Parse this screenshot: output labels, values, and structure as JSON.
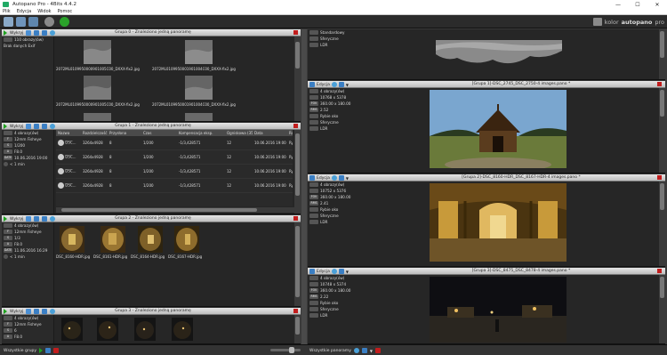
{
  "window": {
    "title": "Autopano Pro - 4Bits 4.4.2",
    "minimize": "—",
    "maximize": "☐",
    "close": "✕"
  },
  "menu": [
    "Plik",
    "Edycja",
    "Widok",
    "Pomoc"
  ],
  "brand": {
    "text": "kolor",
    "product": "autopano",
    "edition": "pro"
  },
  "groups": [
    {
      "title": "Grupa 0 - Znaleziono jedną panoramę",
      "action": "Wykryj",
      "info": [
        "110 obrazy(ów)",
        "Brak danych Exif"
      ],
      "files": [
        "2072ML0109950000901005C00_DXXX-fix2.jpg",
        "2072ML0109950001901004C00_DXXX-fix2.jpg"
      ]
    },
    {
      "title": "Grupa 1 - Znaleziono jedną panoramę",
      "action": "Wykryj",
      "info": [
        "4 obrazy(ów)",
        "12mm Fisheye",
        "1/200",
        "F8.0",
        "10.06.2016 19:00",
        "< 1 min"
      ],
      "badges": [
        "",
        "F",
        "S",
        "A",
        "DATE",
        ""
      ],
      "columns": [
        "Nazwa",
        "Rozdzielczość",
        "Przysłona",
        "Czas",
        "Kompensacja eksp.",
        "Ogniskowa (35mm)",
        "Data",
        "Ro"
      ],
      "rows": [
        [
          "DSC...",
          "3264x4928",
          "8",
          "1/200",
          "-1/3,428571",
          "12",
          "10.06.2016 19:00",
          "Ry"
        ],
        [
          "DSC...",
          "3264x4928",
          "8",
          "1/200",
          "-1/3,428571",
          "12",
          "10.06.2016 19:00",
          "Ry"
        ],
        [
          "DSC...",
          "3264x4928",
          "8",
          "1/200",
          "-1/3,428571",
          "12",
          "10.06.2016 19:00",
          "Ry"
        ],
        [
          "DSC...",
          "3264x4928",
          "8",
          "1/200",
          "-1/3,428571",
          "12",
          "10.06.2016 19:00",
          "Ry"
        ]
      ]
    },
    {
      "title": "Grupa 2 - Znaleziono jedną panoramę",
      "action": "Wykryj",
      "info": [
        "4 obrazy(ów)",
        "12mm Fisheye",
        "1/3",
        "F8.0",
        "11.06.2016 16:29",
        "< 1 min"
      ],
      "badges": [
        "",
        "F",
        "S",
        "A",
        "DATE",
        ""
      ],
      "files": [
        "DSC_8160-HDR.jpg",
        "DSC_8161-HDR.jpg",
        "DSC_8164-HDR.jpg",
        "DSC_8167-HDR.jpg"
      ]
    },
    {
      "title": "Grupa 3 - Znaleziono jedną panoramę",
      "action": "Wykryj",
      "info": [
        "4 obrazy(ów)",
        "12mm Fisheye",
        "6",
        "F8.0"
      ],
      "badges": [
        "",
        "F",
        "S",
        "A"
      ]
    }
  ],
  "panoramas": [
    {
      "title": "",
      "info": [
        "Standardowy",
        "Sferyczne",
        "LDR"
      ]
    },
    {
      "title": "[Grupa 1]-DSC_2745_DSC_2750-4 images.pano *",
      "action": "Edycja",
      "info": [
        "4 obrazy(ów)",
        "10768 x 5378",
        "360.00 x 180.00",
        "2.52",
        "Rybie oko",
        "Sferyczne",
        "LDR"
      ],
      "badges": [
        "",
        "",
        "FOV",
        "RMS",
        "",
        "",
        ""
      ]
    },
    {
      "title": "[Grupa 2]-DSC_8160-HDR_DSC_8167-HDR-4 images.pano *",
      "action": "Edycja",
      "info": [
        "4 obrazy(ów)",
        "10752 x 5376",
        "360.00 x 180.00",
        "2.41",
        "Rybie oko",
        "Sferyczne",
        "LDR"
      ],
      "badges": [
        "",
        "",
        "FOV",
        "RMS",
        "",
        "",
        ""
      ]
    },
    {
      "title": "[Grupa 3]-DSC_8475_DSC_8478-4 images.pano *",
      "action": "Edycja",
      "info": [
        "4 obrazy(ów)",
        "10748 x 5374",
        "360.00 x 180.00",
        "2.22",
        "Rybie oko",
        "Sferyczne",
        "LDR"
      ],
      "badges": [
        "",
        "",
        "FOV",
        "RMS",
        "",
        "",
        ""
      ]
    }
  ],
  "bottom": {
    "left_label": "Wszystkie grupy",
    "right_label": "Wszystkie panoramy",
    "zoom": 0.75
  }
}
